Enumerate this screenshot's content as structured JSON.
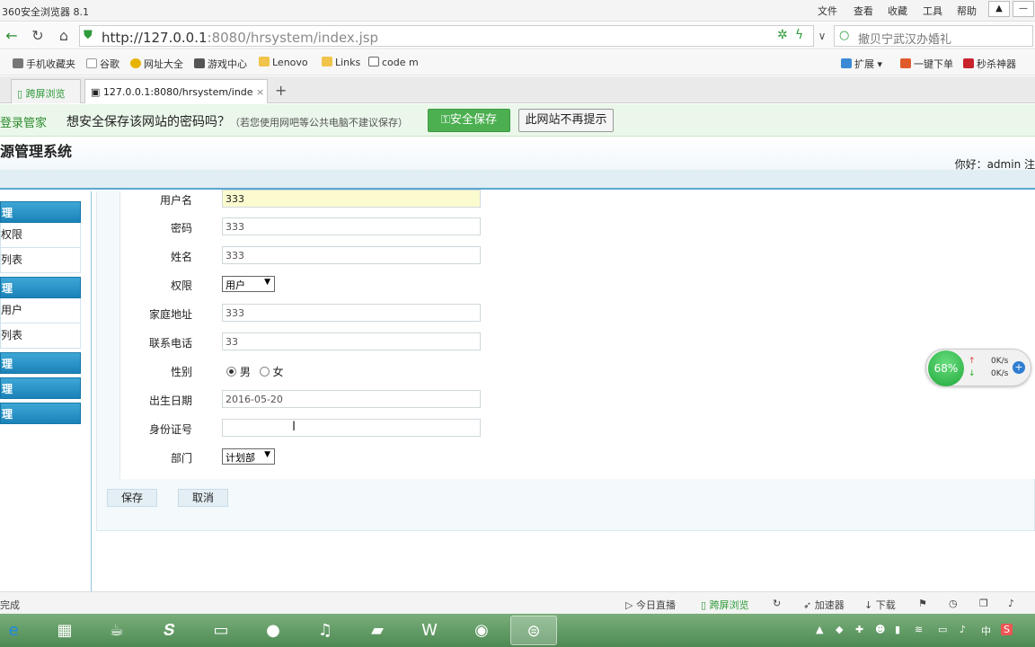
{
  "browser": {
    "title": "360安全浏览器 8.1",
    "menus": [
      "文件",
      "查看",
      "收藏",
      "工具",
      "帮助"
    ],
    "url_host": "http://127.0.0.1",
    "url_rest": ":8080/hrsystem/index.jsp",
    "search_text": "撤贝宁武汉办婚礼",
    "bookmarks": [
      "手机收藏夹",
      "谷歌",
      "网址大全",
      "游戏中心",
      "Lenovo",
      "Links",
      "code m"
    ],
    "extensions": [
      "扩展",
      "一键下单",
      "秒杀神器"
    ],
    "tabs": [
      "跨屏浏览",
      "127.0.0.1:8080/hrsystem/inde"
    ],
    "password_bar": {
      "manager": "登录管家",
      "question": "想安全保存该网站的密码吗？",
      "hint": "（若您使用网吧等公共电脑不建议保存）",
      "save": "安全保存",
      "never": "此网站不再提示"
    }
  },
  "app": {
    "title": "源管理系统",
    "greeting": "你好：admin 注"
  },
  "sidebar": {
    "groups": [
      "理",
      "理",
      "理",
      "理",
      "理"
    ],
    "items": [
      "权限",
      "列表",
      "用户",
      "列表"
    ]
  },
  "form": {
    "fields": [
      {
        "label": "用户名",
        "value": "333"
      },
      {
        "label": "密码",
        "value": "333"
      },
      {
        "label": "姓名",
        "value": "333"
      },
      {
        "label": "权限",
        "value": "用户"
      },
      {
        "label": "家庭地址",
        "value": "333"
      },
      {
        "label": "联系电话",
        "value": "33"
      },
      {
        "label": "性别",
        "value": ""
      },
      {
        "label": "出生日期",
        "value": "2016-05-20"
      },
      {
        "label": "身份证号",
        "value": ""
      },
      {
        "label": "部门",
        "value": "计划部"
      }
    ],
    "gender_male": "男",
    "gender_female": "女",
    "save": "保存",
    "cancel": "取消"
  },
  "speed_widget": {
    "percent": "68%",
    "up": "0K/s",
    "down": "0K/s"
  },
  "statusbar": {
    "left": "完成",
    "items": [
      "今日直播",
      "跨屏浏览",
      "加速器",
      "下载"
    ]
  },
  "taskbar": {
    "tray_text": "中"
  }
}
